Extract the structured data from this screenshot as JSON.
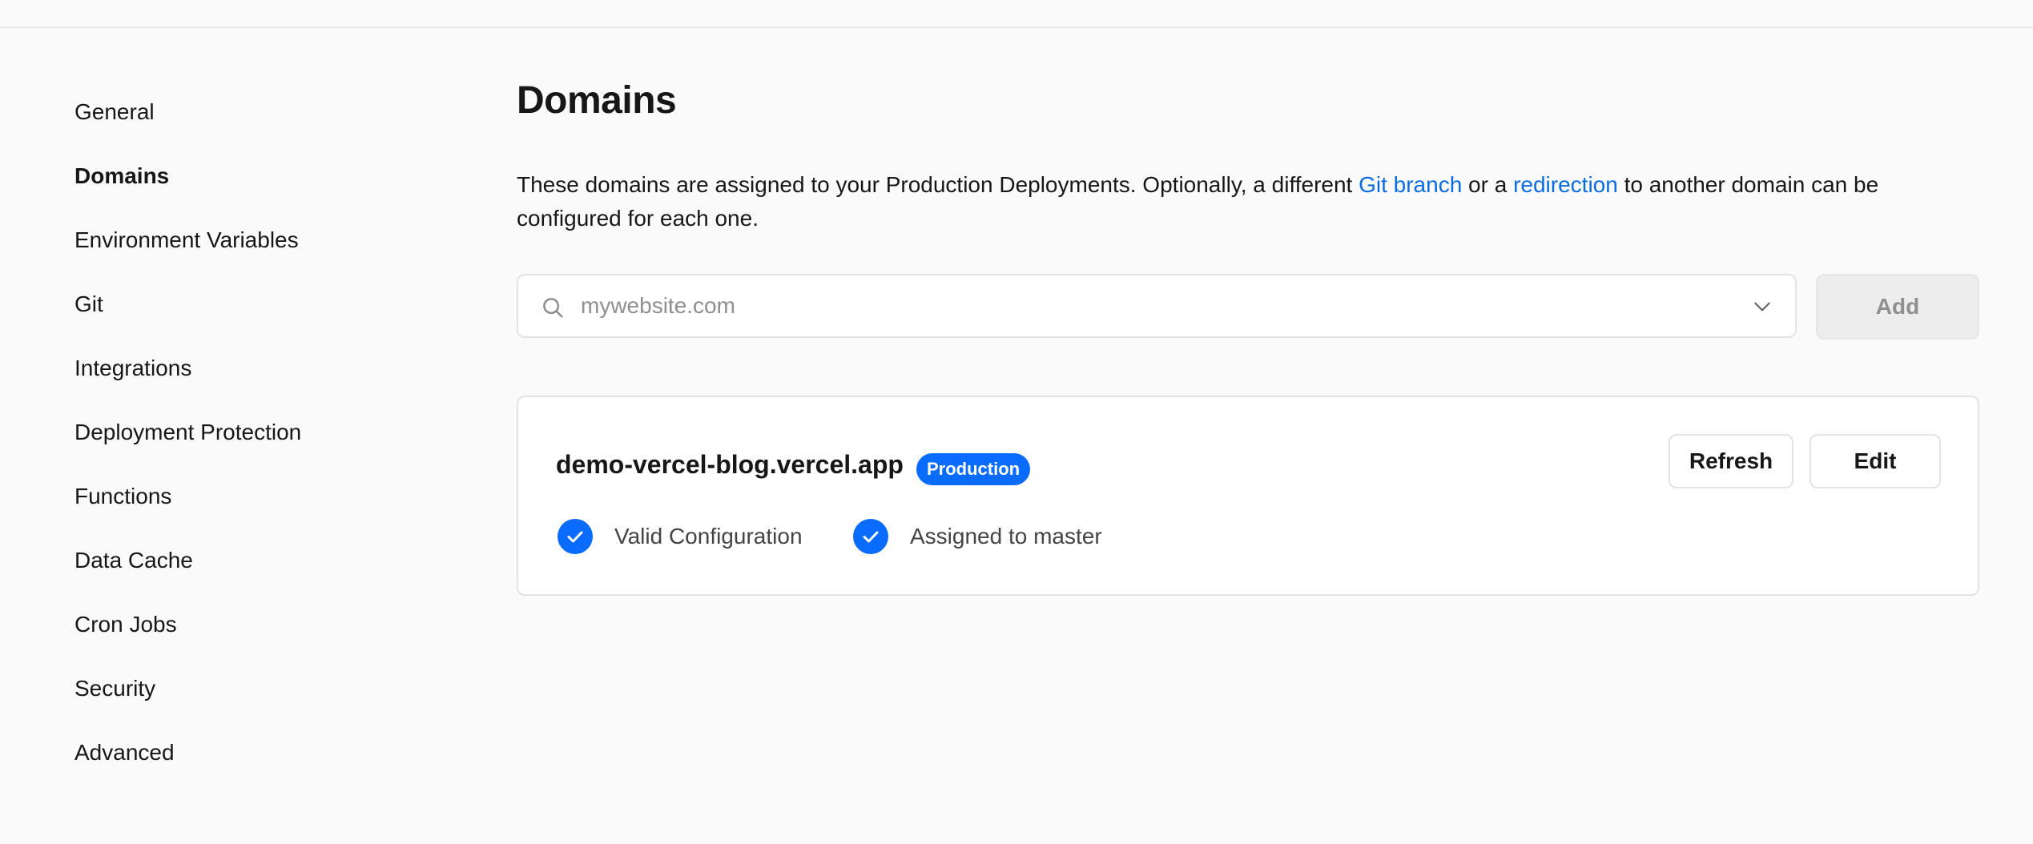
{
  "sidebar": {
    "items": [
      {
        "label": "General",
        "active": false
      },
      {
        "label": "Domains",
        "active": true
      },
      {
        "label": "Environment Variables",
        "active": false
      },
      {
        "label": "Git",
        "active": false
      },
      {
        "label": "Integrations",
        "active": false
      },
      {
        "label": "Deployment Protection",
        "active": false
      },
      {
        "label": "Functions",
        "active": false
      },
      {
        "label": "Data Cache",
        "active": false
      },
      {
        "label": "Cron Jobs",
        "active": false
      },
      {
        "label": "Security",
        "active": false
      },
      {
        "label": "Advanced",
        "active": false
      }
    ]
  },
  "main": {
    "title": "Domains",
    "description": {
      "part1": "These domains are assigned to your Production Deployments. Optionally, a different ",
      "link1": "Git branch",
      "part2": " or a ",
      "link2": "redirection",
      "part3": " to another domain can be configured for each one."
    },
    "search": {
      "placeholder": "mywebsite.com",
      "value": "",
      "icon": "search-icon",
      "dropdown_icon": "chevron-down-icon"
    },
    "add_label": "Add",
    "domain_card": {
      "name": "demo-vercel-blog.vercel.app",
      "badge": "Production",
      "refresh_label": "Refresh",
      "edit_label": "Edit",
      "statuses": [
        {
          "label": "Valid Configuration",
          "icon": "check-circle-icon"
        },
        {
          "label": "Assigned to master",
          "icon": "check-circle-icon"
        }
      ]
    }
  },
  "colors": {
    "accent": "#0a6cff",
    "link": "#0a6cdf",
    "background": "#fafafa",
    "card": "#ffffff",
    "border": "#e3e3e3",
    "disabled_button": "#ededed"
  }
}
